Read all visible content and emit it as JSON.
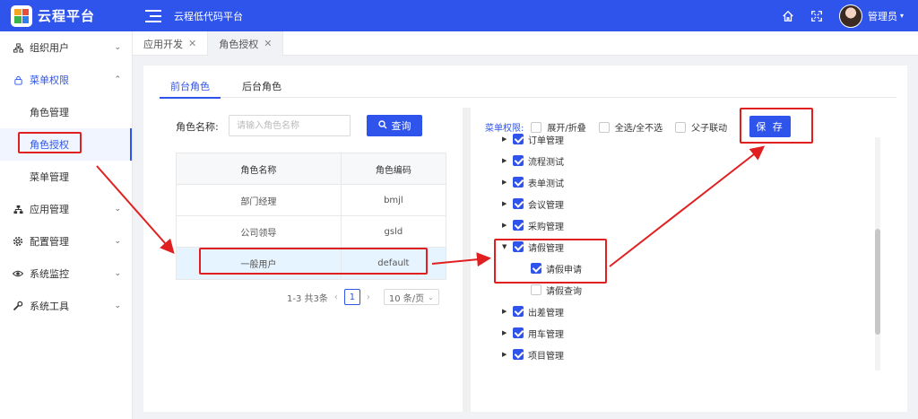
{
  "header": {
    "brand": "云程平台",
    "platform_title": "云程低代码平台",
    "user_name": "管理员"
  },
  "sidebar": {
    "items": [
      {
        "label": "组织用户",
        "icon": "org-icon"
      },
      {
        "label": "菜单权限",
        "icon": "lock-icon"
      },
      {
        "label": "应用管理",
        "icon": "app-icon"
      },
      {
        "label": "配置管理",
        "icon": "gear-icon"
      },
      {
        "label": "系统监控",
        "icon": "eye-icon"
      },
      {
        "label": "系统工具",
        "icon": "wrench-icon"
      }
    ],
    "sub_items": [
      "角色管理",
      "角色授权",
      "菜单管理"
    ]
  },
  "tabs": [
    "应用开发",
    "角色授权"
  ],
  "role_tabs": [
    "前台角色",
    "后台角色"
  ],
  "search": {
    "label": "角色名称:",
    "placeholder": "请输入角色名称",
    "button": "查询"
  },
  "table": {
    "headers": [
      "角色名称",
      "角色编码"
    ],
    "rows": [
      [
        "部门经理",
        "bmjl"
      ],
      [
        "公司领导",
        "gsld"
      ],
      [
        "一般用户",
        "default"
      ]
    ]
  },
  "pager": {
    "summary": "1-3 共3条",
    "page": "1",
    "size": "10 条/页"
  },
  "tree_toolbar": {
    "label": "菜单权限:",
    "expand": "展开/折叠",
    "select_all": "全选/全不选",
    "linkage": "父子联动",
    "save": "保 存"
  },
  "tree": [
    {
      "label": "订单管理",
      "checked": true,
      "expanded": false
    },
    {
      "label": "流程测试",
      "checked": true,
      "expanded": false
    },
    {
      "label": "表单测试",
      "checked": true,
      "expanded": false
    },
    {
      "label": "会议管理",
      "checked": true,
      "expanded": false
    },
    {
      "label": "采购管理",
      "checked": true,
      "expanded": false
    },
    {
      "label": "请假管理",
      "checked": true,
      "expanded": true
    },
    {
      "label": "请假申请",
      "checked": true,
      "child": true
    },
    {
      "label": "请假查询",
      "checked": false,
      "child": true
    },
    {
      "label": "出差管理",
      "checked": true,
      "expanded": false
    },
    {
      "label": "用车管理",
      "checked": true,
      "expanded": false
    },
    {
      "label": "项目管理",
      "checked": true,
      "expanded": false
    }
  ],
  "colors": {
    "primary": "#2f54eb",
    "annotation_red": "#e02020"
  }
}
